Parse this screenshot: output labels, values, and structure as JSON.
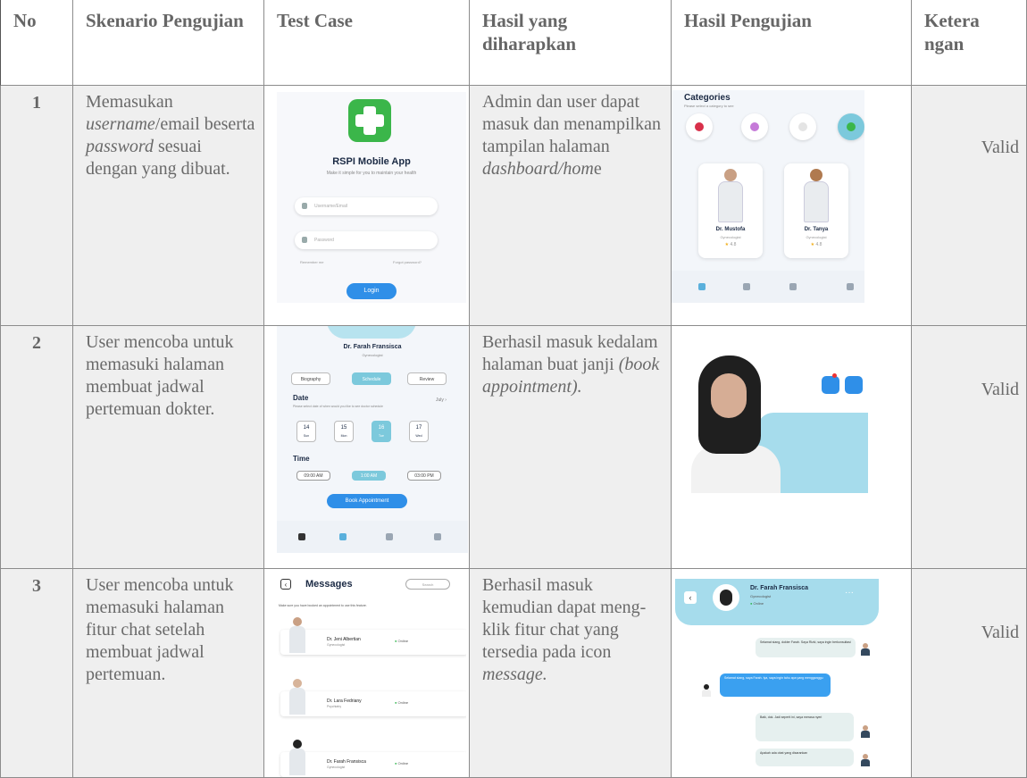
{
  "headers": {
    "no": "No",
    "skenario": "Skenario Pengujian",
    "test_case": "Test Case",
    "hasil_diharapkan": "Hasil yang diharapkan",
    "hasil_pengujian": "Hasil Pengujian",
    "keterangan": "Ketera ngan"
  },
  "rows": [
    {
      "no": "1",
      "skenario": {
        "p1": "Memasukan ",
        "i1": "username",
        "p2": "/email beserta ",
        "i2": "password",
        "p3": " sesuai dengan yang dibuat."
      },
      "expected": {
        "p1": "Admin dan user dapat masuk dan menampilkan tampilan halaman ",
        "i1": "dashboard/hom",
        "p2": "e"
      },
      "keterangan": "Valid"
    },
    {
      "no": "2",
      "skenario": "User mencoba untuk memasuki halaman membuat jadwal pertemuan dokter.",
      "expected": {
        "p1": "Berhasil masuk kedalam halaman buat janji ",
        "i1": "(book appointment)."
      },
      "keterangan": "Valid"
    },
    {
      "no": "3",
      "skenario": "User mencoba untuk memasuki halaman fitur chat setelah membuat jadwal pertemuan.",
      "expected": {
        "p1": "Berhasil masuk kemudian dapat meng-klik fitur chat yang tersedia pada icon ",
        "i1": "message."
      },
      "keterangan": "Valid"
    }
  ],
  "screens": {
    "login": {
      "title": "RSPI Mobile App",
      "subtitle": "Make it simple for you to maintain your health",
      "username_placeholder": "Username/Email",
      "password_placeholder": "Password",
      "remember": "Remember me",
      "forgot": "Forgot password?",
      "login_button": "Login",
      "accent": "#2f8fe8",
      "logo_color": "#3bb64a"
    },
    "dashboard": {
      "title": "Categories",
      "subtitle": "Please select a category to see",
      "doctors": [
        {
          "name": "Dr. Mustofa",
          "spec": "Gynecologist",
          "rating": "4.8"
        },
        {
          "name": "Dr. Tanya",
          "spec": "Gynecologist",
          "rating": "4.8"
        }
      ]
    },
    "schedule": {
      "doctor": "Dr. Farah Fransisca",
      "spec": "Gynecologist",
      "tabs": [
        "Biography",
        "Schedule",
        "Review"
      ],
      "date_title": "Date",
      "date_sub": "Please select date of when would you like to see doctor schedule",
      "month": "July",
      "dates": [
        {
          "d": "14",
          "w": "Sun"
        },
        {
          "d": "15",
          "w": "Mon"
        },
        {
          "d": "16",
          "w": "Tue"
        },
        {
          "d": "17",
          "w": "Wed"
        }
      ],
      "time_title": "Time",
      "times": [
        "09:00 AM",
        "1:00 AM",
        "03:00 PM"
      ],
      "book_button": "Book Appointment"
    },
    "messages": {
      "title": "Messages",
      "search": "Search",
      "note": "Make sure you have booked an appointment to use this feature.",
      "chats": [
        {
          "name": "Dr. Jeni Albertian",
          "spec": "Gynecologist",
          "status": "Online"
        },
        {
          "name": "Dr. Lara Fedriany",
          "spec": "Psychiatry",
          "status": "Online"
        },
        {
          "name": "Dr. Farah Fransisca",
          "spec": "Gynecologist",
          "status": "Online"
        }
      ]
    },
    "chat": {
      "doctor": "Dr. Farah Fransisca",
      "spec": "Gynecologist",
      "status": "Online",
      "bubbles": [
        "Selamat siang, dokter Farah. Saya Rizki, saya ingin berkonsultasi",
        "Selamat siang, saya Farah. Iya, saya ingin tahu apa yang mengganggu",
        "Baik, dok. Jadi seperti ini, saya merasa nyeri",
        "Apakah ada obat yang disarankan"
      ]
    }
  }
}
